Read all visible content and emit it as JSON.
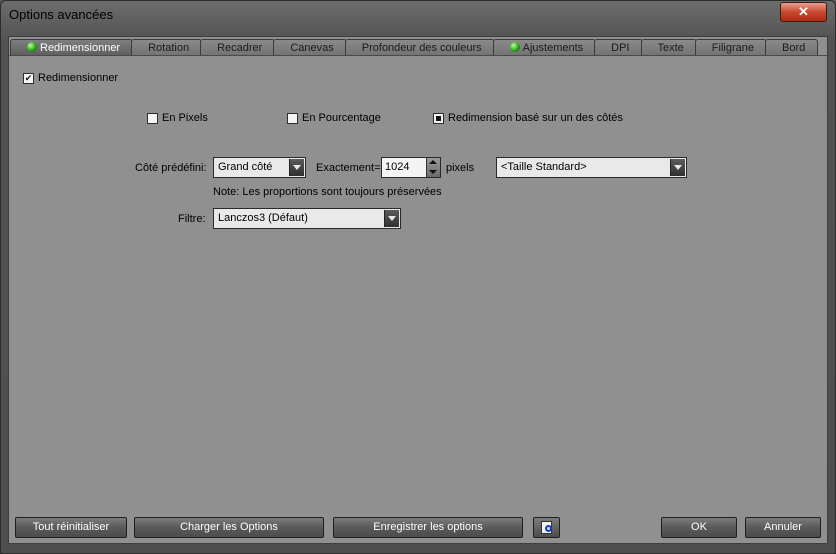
{
  "window": {
    "title": "Options avancées",
    "close_symbol": "✕"
  },
  "tabs": [
    {
      "label": "Redimensionner",
      "active": true,
      "indicator": true
    },
    {
      "label": "Rotation",
      "active": false,
      "indicator": false
    },
    {
      "label": "Recadrer",
      "active": false,
      "indicator": false
    },
    {
      "label": "Canevas",
      "active": false,
      "indicator": false
    },
    {
      "label": "Profondeur des couleurs",
      "active": false,
      "indicator": false
    },
    {
      "label": "Ajustements",
      "active": false,
      "indicator": true
    },
    {
      "label": "DPI",
      "active": false,
      "indicator": false
    },
    {
      "label": "Texte",
      "active": false,
      "indicator": false
    },
    {
      "label": "Filigrane",
      "active": false,
      "indicator": false
    },
    {
      "label": "Bord",
      "active": false,
      "indicator": false
    }
  ],
  "resize": {
    "enable_label": "Redimensionner",
    "enable_checked": true,
    "mode_pixels": "En Pixels",
    "mode_percent": "En Pourcentage",
    "mode_side": "Redimension basé sur un des côtés",
    "preset_side_label": "Côté prédéfini:",
    "preset_side_value": "Grand côté",
    "exact_label": "Exactement=",
    "exact_value": "1024",
    "unit_label": "pixels",
    "standard_size_value": "<Taille Standard>",
    "note": "Note: Les proportions sont toujours préservées",
    "filter_label": "Filtre:",
    "filter_value": "Lanczos3 (Défaut)"
  },
  "footer": {
    "reset_all": "Tout réinitialiser",
    "load_options": "Charger les Options",
    "save_options": "Enregistrer les options",
    "ok": "OK",
    "cancel": "Annuler"
  },
  "colors": {
    "panel": "#909090",
    "indicator_green": "#1f9b0f",
    "close_red": "#c9482f"
  }
}
